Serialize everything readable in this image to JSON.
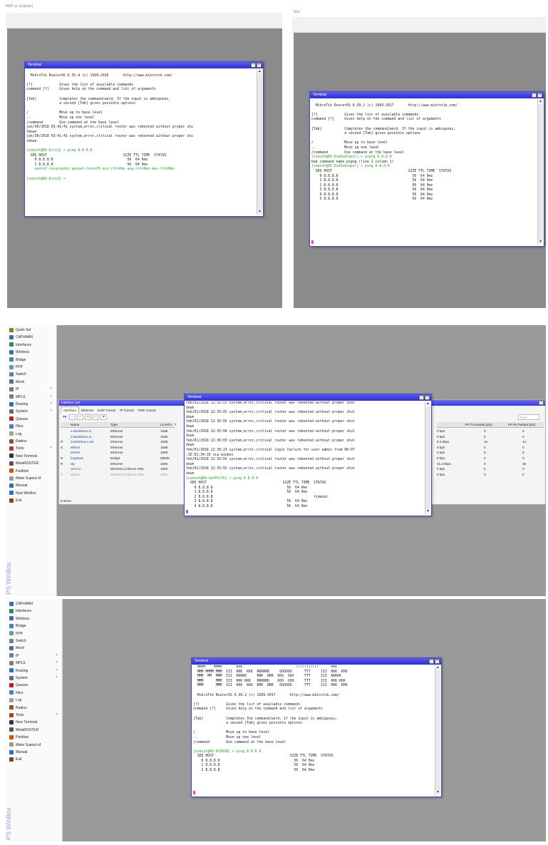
{
  "panel1": {
    "caption": "MAP ac (mipsbe)",
    "terminal": {
      "title": "Terminal",
      "lines": [
        {
          "t": "",
          "k": ""
        },
        {
          "t": "  MikroTik RouterOS 6.35.4 (c) 1999-2016       http://www.mikrotik.com/",
          "k": ""
        },
        {
          "t": "",
          "k": ""
        },
        {
          "t": "[?]             Gives the list of available commands",
          "k": ""
        },
        {
          "t": "command [?]     Gives help on the command and list of arguments",
          "k": ""
        },
        {
          "t": "",
          "k": ""
        },
        {
          "t": "[Tab]           Completes the command/word. If the input is ambiguous,",
          "k": ""
        },
        {
          "t": "                a second [Tab] gives possible options",
          "k": ""
        },
        {
          "t": "",
          "k": ""
        },
        {
          "t": "/               Move up to base level",
          "k": ""
        },
        {
          "t": "..              Move up one level",
          "k": ""
        },
        {
          "t": "/command        Use command at the base level",
          "k": ""
        },
        {
          "t": "jan/30/2018 03:41:41 system,error,critical router was rebooted without proper shu",
          "k": ""
        },
        {
          "t": "tdown",
          "k": ""
        },
        {
          "t": "jan/30/2018 03:41:41 system,error,critical router was rebooted without proper shu",
          "k": ""
        },
        {
          "t": "tdown",
          "k": ""
        },
        {
          "t": "",
          "k": ""
        },
        {
          "t": "[sominf@RO.DirLS] > ping 8.8.8.8",
          "k": "prompt"
        },
        {
          "t": "  SEQ HOST                                     SIZE TTL TIME  STATUS",
          "k": ""
        },
        {
          "t": "    0 8.8.8.8                                    56  64 0ms",
          "k": ""
        },
        {
          "t": "    1 8.8.8.8                                    56  64 0ms",
          "k": ""
        },
        {
          "t": "    sent=2 received=2 packet-loss=0% min-rtt=0ms avg-rtt=0ms max-rtt=0ms",
          "k": "prompt"
        },
        {
          "t": "",
          "k": ""
        },
        {
          "t": "[sominf@RO.DirLS] > ",
          "k": "prompt"
        }
      ]
    }
  },
  "panel2": {
    "caption": "(be)",
    "terminal": {
      "title": "Terminal",
      "lines": [
        {
          "t": "",
          "k": ""
        },
        {
          "t": "  MikroTik RouterOS 6.39.2 (c) 1999-2017       http://www.mikrotik.com/",
          "k": ""
        },
        {
          "t": "",
          "k": ""
        },
        {
          "t": "[?]             Gives the list of available commands",
          "k": ""
        },
        {
          "t": "command [?]     Gives help on the command and list of arguments",
          "k": ""
        },
        {
          "t": "",
          "k": ""
        },
        {
          "t": "[Tab]           Completes the command/word. If the input is ambiguous,",
          "k": ""
        },
        {
          "t": "                a second [Tab] gives possible options",
          "k": ""
        },
        {
          "t": "",
          "k": ""
        },
        {
          "t": "/               Move up to base level",
          "k": ""
        },
        {
          "t": "..              Move up one level",
          "k": ""
        },
        {
          "t": "/command        Use command at the base level",
          "k": ""
        },
        {
          "t": "[sominf@RO.DinDukCapil] > pipng 8.8.8.8",
          "k": "prompt"
        },
        {
          "t": "bad command name pipng (line 1 column 1)",
          "k": ""
        },
        {
          "t": "[sominf@RO.DinDukCapil] > ping 8.8.8.8",
          "k": "prompt"
        },
        {
          "t": "  SEQ HOST                                     SIZE TTL TIME  STATUS",
          "k": ""
        },
        {
          "t": "    0 8.8.8.8                                    56  64 0ms",
          "k": ""
        },
        {
          "t": "    1 8.8.8.8                                    56  64 0ms",
          "k": ""
        },
        {
          "t": "    2 8.8.8.8                                    56  64 0ms",
          "k": ""
        },
        {
          "t": "    3 8.8.8.8                                    56  64 0ms",
          "k": ""
        },
        {
          "t": "    4 8.8.8.8                                    56  64 0ms",
          "k": ""
        },
        {
          "t": "    5 8.8.8.8                                    56  64 0ms",
          "k": ""
        }
      ]
    }
  },
  "menu": [
    {
      "label": "Quick Set",
      "icon": "quick-set-icon",
      "color": "#6b8e23",
      "sub": false
    },
    {
      "label": "CAPsMAN",
      "icon": "capsman-icon",
      "color": "#3a6ea5",
      "sub": false
    },
    {
      "label": "Interfaces",
      "icon": "interfaces-icon",
      "color": "#2e8b57",
      "sub": false
    },
    {
      "label": "Wireless",
      "icon": "wireless-icon",
      "color": "#3a6ea5",
      "sub": false
    },
    {
      "label": "Bridge",
      "icon": "bridge-icon",
      "color": "#4682b4",
      "sub": false
    },
    {
      "label": "PPP",
      "icon": "ppp-icon",
      "color": "#5f9ea0",
      "sub": false
    },
    {
      "label": "Switch",
      "icon": "switch-icon",
      "color": "#708090",
      "sub": false
    },
    {
      "label": "Mesh",
      "icon": "mesh-icon",
      "color": "#4f6f8f",
      "sub": false
    },
    {
      "label": "IP",
      "icon": "ip-icon",
      "color": "#7a7a7a",
      "sub": true
    },
    {
      "label": "MPLS",
      "icon": "mpls-icon",
      "color": "#7a7a7a",
      "sub": true
    },
    {
      "label": "Routing",
      "icon": "routing-icon",
      "color": "#2a6fc9",
      "sub": true
    },
    {
      "label": "System",
      "icon": "system-icon",
      "color": "#6a6a6a",
      "sub": true
    },
    {
      "label": "Queues",
      "icon": "queues-icon",
      "color": "#b22222",
      "sub": false
    },
    {
      "label": "Files",
      "icon": "files-icon",
      "color": "#4a7bd0",
      "sub": false
    },
    {
      "label": "Log",
      "icon": "log-icon",
      "color": "#a0a0a0",
      "sub": false
    },
    {
      "label": "Radius",
      "icon": "radius-icon",
      "color": "#8a5a2a",
      "sub": false
    },
    {
      "label": "Tools",
      "icon": "tools-icon",
      "color": "#c0392b",
      "sub": true
    },
    {
      "label": "New Terminal",
      "icon": "terminal-icon",
      "color": "#333333",
      "sub": false
    },
    {
      "label": "MetaROUTER",
      "icon": "metarouter-icon",
      "color": "#555555",
      "sub": false
    },
    {
      "label": "Partition",
      "icon": "partition-icon",
      "color": "#d35400",
      "sub": false
    },
    {
      "label": "Make Supout.rif",
      "icon": "supout-icon",
      "color": "#999999",
      "sub": false
    },
    {
      "label": "Manual",
      "icon": "manual-icon",
      "color": "#2a6fc9",
      "sub": false
    },
    {
      "label": "New WinBox",
      "icon": "winbox-icon",
      "color": "#2a6fc9",
      "sub": false
    },
    {
      "label": "Exit",
      "icon": "exit-icon",
      "color": "#8b4513",
      "sub": false
    }
  ],
  "menu2": [
    {
      "label": "CAPsMAN",
      "icon": "capsman-icon",
      "color": "#3a6ea5",
      "sub": false
    },
    {
      "label": "Interfaces",
      "icon": "interfaces-icon",
      "color": "#2e8b57",
      "sub": false
    },
    {
      "label": "Wireless",
      "icon": "wireless-icon",
      "color": "#3a6ea5",
      "sub": false
    },
    {
      "label": "Bridge",
      "icon": "bridge-icon",
      "color": "#4682b4",
      "sub": false
    },
    {
      "label": "PPP",
      "icon": "ppp-icon",
      "color": "#5f9ea0",
      "sub": false
    },
    {
      "label": "Switch",
      "icon": "switch-icon",
      "color": "#708090",
      "sub": false
    },
    {
      "label": "Mesh",
      "icon": "mesh-icon",
      "color": "#4f6f8f",
      "sub": false
    },
    {
      "label": "IP",
      "icon": "ip-icon",
      "color": "#7a7a7a",
      "sub": true
    },
    {
      "label": "MPLS",
      "icon": "mpls-icon",
      "color": "#7a7a7a",
      "sub": true
    },
    {
      "label": "Routing",
      "icon": "routing-icon",
      "color": "#2a6fc9",
      "sub": true
    },
    {
      "label": "System",
      "icon": "system-icon",
      "color": "#6a6a6a",
      "sub": true
    },
    {
      "label": "Queues",
      "icon": "queues-icon",
      "color": "#b22222",
      "sub": false
    },
    {
      "label": "Files",
      "icon": "files-icon",
      "color": "#4a7bd0",
      "sub": false
    },
    {
      "label": "Log",
      "icon": "log-icon",
      "color": "#a0a0a0",
      "sub": false
    },
    {
      "label": "Radius",
      "icon": "radius-icon",
      "color": "#8a5a2a",
      "sub": false
    },
    {
      "label": "Tools",
      "icon": "tools-icon",
      "color": "#c0392b",
      "sub": true
    },
    {
      "label": "New Terminal",
      "icon": "terminal-icon",
      "color": "#333333",
      "sub": false
    },
    {
      "label": "MetaROUTER",
      "icon": "metarouter-icon",
      "color": "#555555",
      "sub": false
    },
    {
      "label": "Partition",
      "icon": "partition-icon",
      "color": "#d35400",
      "sub": false
    },
    {
      "label": "Make Supout.rif",
      "icon": "supout-icon",
      "color": "#999999",
      "sub": false
    },
    {
      "label": "Manual",
      "icon": "manual-icon",
      "color": "#2a6fc9",
      "sub": false
    },
    {
      "label": "Exit",
      "icon": "exit-icon",
      "color": "#8b4513",
      "sub": false
    }
  ],
  "winbox_label": "PS WinBox",
  "iface": {
    "title": "Interface List",
    "tabs": [
      "Interface",
      "Ethernet",
      "EoIP Tunnel",
      "IP Tunnel",
      "GRE Tunnel"
    ],
    "headers": [
      "Name",
      "Type",
      "L2 MTU",
      "T"
    ],
    "rows": [
      {
        "flag": "",
        "name": "1-Backbone G..",
        "type": "Ethernet",
        "mtu": "1598"
      },
      {
        "flag": "",
        "name": "2-Backbone G..",
        "type": "Ethernet",
        "mtu": "1598"
      },
      {
        "flag": "R",
        "name": "3-Distribus LAN",
        "type": "Ethernet",
        "mtu": "1598"
      },
      {
        "flag": "S",
        "name": "ether4",
        "type": "Ethernet",
        "mtu": "1598"
      },
      {
        "flag": "",
        "name": "ether5",
        "type": "Ethernet",
        "mtu": "1598"
      },
      {
        "flag": "R",
        "name": "loopback",
        "type": "Bridge",
        "mtu": "65535"
      },
      {
        "flag": "R",
        "name": "vlp",
        "type": "Ethernet",
        "mtu": "1600"
      },
      {
        "flag": "",
        "name": "wlan10",
        "type": "Wireless (Atheros AR9..",
        "mtu": "1600"
      },
      {
        "flag": "X",
        "name": "wlan11",
        "type": "Wireless (Atheros AR9..",
        "mtu": "1600"
      }
    ],
    "status": "9 items",
    "find": "Find",
    "right_headers": [
      "FP Tx Packet (p/s)",
      "FP Rx Packet (p/s)"
    ],
    "right_rows": [
      {
        "rate": "0 bps",
        "tx": "0",
        "rx": "0"
      },
      {
        "rate": "0 bps",
        "tx": "0",
        "rx": "0"
      },
      {
        "rate": "8.2 kbps",
        "tx": "15",
        "rx": "14"
      },
      {
        "rate": "0 bps",
        "tx": "0",
        "rx": "0"
      },
      {
        "rate": "0 bps",
        "tx": "0",
        "rx": "0"
      },
      {
        "rate": "0 bps",
        "tx": "0",
        "rx": "0"
      },
      {
        "rate": "31.2 kbps",
        "tx": "0",
        "rx": "36"
      },
      {
        "rate": "0 bps",
        "tx": "0",
        "rx": "0"
      },
      {
        "rate": "0 bps",
        "tx": "0",
        "rx": "0"
      }
    ]
  },
  "panel3": {
    "terminal": {
      "title": "Terminal",
      "lines": [
        {
          "t": "feb/01/2018 12:35:03 system,error,critical router was rebooted without proper shut",
          "k": ""
        },
        {
          "t": "down",
          "k": ""
        },
        {
          "t": "feb/01/2018 12:35:01 system,error,critical router was rebooted without proper shut",
          "k": ""
        },
        {
          "t": "down",
          "k": ""
        },
        {
          "t": "feb/01/2018 12:35:02 system,error,critical router was rebooted without proper shut",
          "k": ""
        },
        {
          "t": "down",
          "k": ""
        },
        {
          "t": "feb/01/2018 12:35:04 system,error,critical router was rebooted without proper shut",
          "k": ""
        },
        {
          "t": "down",
          "k": ""
        },
        {
          "t": "feb/01/2018 12:36:03 system,error,critical router was rebooted without proper shut",
          "k": ""
        },
        {
          "t": "down",
          "k": ""
        },
        {
          "t": "feb/01/2018 12:36:23 system,error,critical login failure for user admin from 00:07",
          "k": ""
        },
        {
          "t": ":1E:01:34:16 via winbox",
          "k": ""
        },
        {
          "t": "feb/01/2018 12:35:01 system,error,critical router was rebooted without proper shut",
          "k": ""
        },
        {
          "t": "down",
          "k": ""
        },
        {
          "t": "feb/01/2018 12:35:02 system,error,critical router was rebooted without proper shut",
          "k": ""
        },
        {
          "t": "down",
          "k": ""
        },
        {
          "t": "[sominf@RO.SetPol35] > ping 8.8.8.8",
          "k": "prompt"
        },
        {
          "t": "  SEQ HOST                                     SIZE TTL TIME  STATUS",
          "k": ""
        },
        {
          "t": "    0 8.8.8.8                                    56  64 0ms",
          "k": ""
        },
        {
          "t": "    1 8.8.8.8                                    56  64 0ms",
          "k": ""
        },
        {
          "t": "    2 8.8.8.8                                                 timeout",
          "k": ""
        },
        {
          "t": "    3 8.8.8.8                                    56  64 0ms",
          "k": ""
        },
        {
          "t": "    4 8.8.8.8                                    56  64 0ms",
          "k": ""
        }
      ]
    }
  },
  "panel4": {
    "terminal": {
      "title": "Terminal",
      "lines": [
        {
          "t": "  MMMM    MMMM       KKK                          TTTTTTTTTTT      KKK",
          "k": ""
        },
        {
          "t": "  MMM MMMM MMM  III  KKK  KKK  RRRRRR     OOOOOO      TTT     III  KKK  KKK",
          "k": ""
        },
        {
          "t": "  MMM  MM  MMM  III  KKKKK     RRR  RRR  OOO  OOO     TTT     III  KKKKK",
          "k": ""
        },
        {
          "t": "  MMM      MMM  III  KKK KKK   RRRRRR    OOO  OOO     TTT     III  KKK KKK",
          "k": ""
        },
        {
          "t": "  MMM      MMM  III  KKK  KKK  RRR  RRR   OOOOOO      TTT     III  KKK  KKK",
          "k": ""
        },
        {
          "t": "",
          "k": ""
        },
        {
          "t": "  MikroTik RouterOS 6.39.2 (c) 1999-2017       http://www.mikrotik.com/",
          "k": ""
        },
        {
          "t": "",
          "k": ""
        },
        {
          "t": "[?]             Gives the list of available commands",
          "k": ""
        },
        {
          "t": "command [?]     Gives help on the command and list of arguments",
          "k": ""
        },
        {
          "t": "",
          "k": ""
        },
        {
          "t": "[Tab]           Completes the command/word. If the input is ambiguous,",
          "k": ""
        },
        {
          "t": "                a second [Tab] gives possible options",
          "k": ""
        },
        {
          "t": "",
          "k": ""
        },
        {
          "t": "/               Move up to base level",
          "k": ""
        },
        {
          "t": "..              Move up one level",
          "k": ""
        },
        {
          "t": "/command        Use command at the base level",
          "k": ""
        },
        {
          "t": "",
          "k": ""
        },
        {
          "t": "[sominf@RO.DISKUB] > ping 8.8.8.8",
          "k": "prompt"
        },
        {
          "t": "  SEQ HOST                                     SIZE TTL TIME  STATUS",
          "k": ""
        },
        {
          "t": "    0 8.8.8.8                                    56  64 0ms",
          "k": ""
        },
        {
          "t": "    1 8.8.8.8                                    56  64 0ms",
          "k": ""
        },
        {
          "t": "    2 8.8.8.8                                    56  64 0ms",
          "k": ""
        }
      ]
    }
  },
  "colors": {
    "title_bar": "#3b3bd8",
    "prompt": "#2b9a2b",
    "cursor": "#e04db5",
    "desktop": "#8b8b8b"
  }
}
